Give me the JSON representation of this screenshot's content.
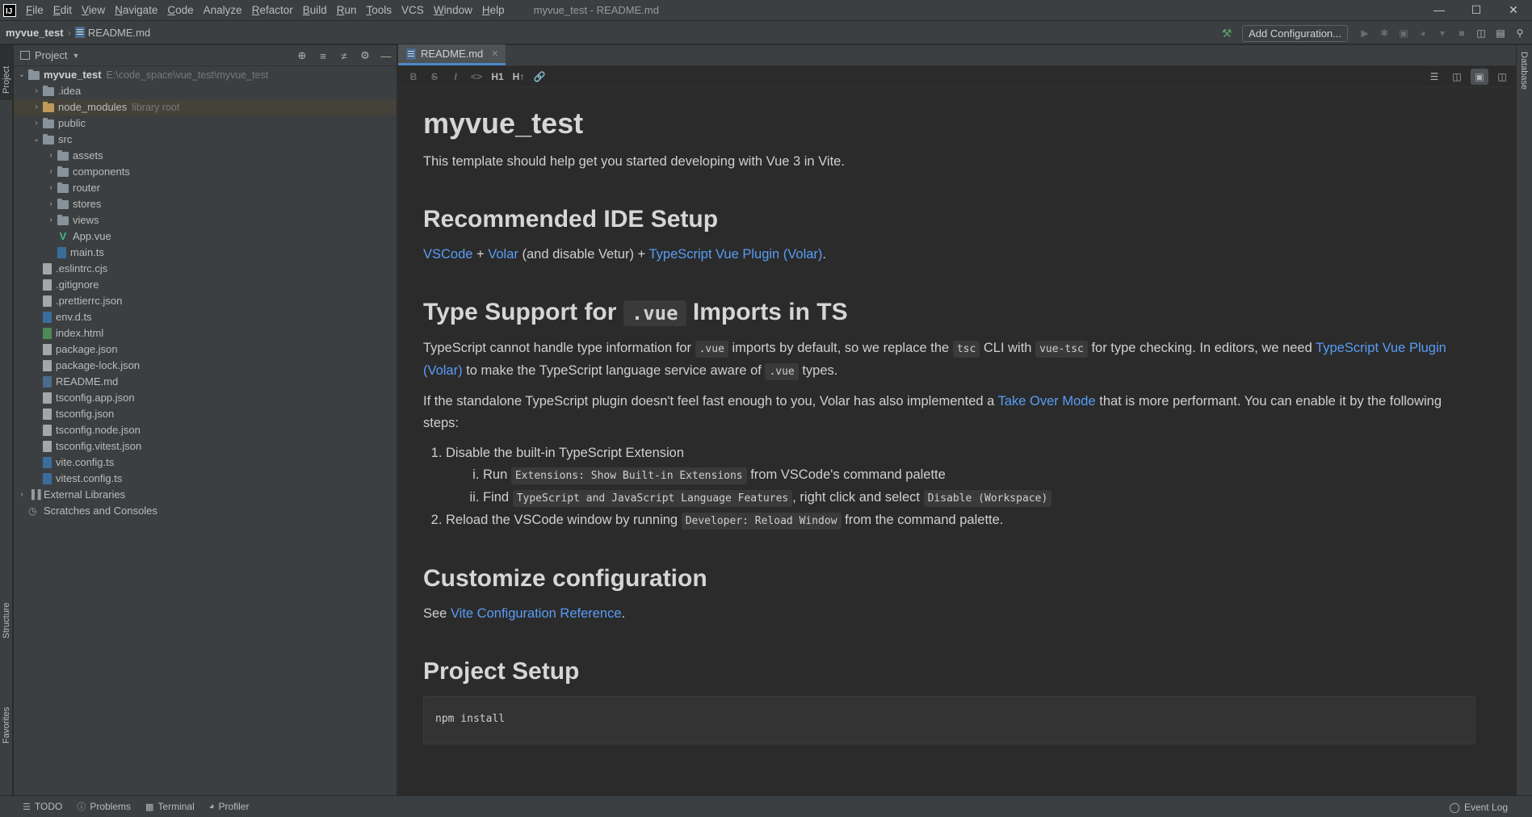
{
  "window": {
    "title": "myvue_test - README.md",
    "logo": "IJ"
  },
  "menu": {
    "items": [
      {
        "u": "F",
        "rest": "ile"
      },
      {
        "u": "E",
        "rest": "dit"
      },
      {
        "u": "V",
        "rest": "iew"
      },
      {
        "u": "N",
        "rest": "avigate"
      },
      {
        "u": "C",
        "rest": "ode"
      },
      {
        "u": "",
        "rest": "Analyze"
      },
      {
        "u": "R",
        "rest": "efactor"
      },
      {
        "u": "B",
        "rest": "uild"
      },
      {
        "u": "R",
        "rest": "un"
      },
      {
        "u": "T",
        "rest": "ools"
      },
      {
        "u": "",
        "rest": "VCS"
      },
      {
        "u": "W",
        "rest": "indow"
      },
      {
        "u": "H",
        "rest": "elp"
      }
    ]
  },
  "breadcrumb": {
    "project": "myvue_test",
    "file": "README.md"
  },
  "toolbar": {
    "add_config_label": "Add Configuration..."
  },
  "left_strip": {
    "project_label": "Project",
    "structure_label": "Structure",
    "favorites_label": "Favorites"
  },
  "right_strip": {
    "database_label": "Database"
  },
  "project_panel": {
    "title": "Project",
    "tree": {
      "root_name": "myvue_test",
      "root_path": "E:\\code_space\\vue_test\\myvue_test",
      "idea": ".idea",
      "node_modules": "node_modules",
      "node_modules_hint": "library root",
      "public": "public",
      "src": "src",
      "assets": "assets",
      "components": "components",
      "router": "router",
      "stores": "stores",
      "views": "views",
      "app_vue": "App.vue",
      "main_ts": "main.ts",
      "eslintrc": ".eslintrc.cjs",
      "gitignore": ".gitignore",
      "prettierrc": ".prettierrc.json",
      "env_d_ts": "env.d.ts",
      "index_html": "index.html",
      "package_json": "package.json",
      "package_lock": "package-lock.json",
      "readme": "README.md",
      "tsconfig_app": "tsconfig.app.json",
      "tsconfig": "tsconfig.json",
      "tsconfig_node": "tsconfig.node.json",
      "tsconfig_vitest": "tsconfig.vitest.json",
      "vite_config": "vite.config.ts",
      "vitest_config": "vitest.config.ts",
      "external_libraries": "External Libraries",
      "scratches": "Scratches and Consoles"
    }
  },
  "editor": {
    "tab_label": "README.md",
    "md_toolbar": {
      "bold": "B",
      "strike": "S",
      "italic": "I",
      "code": "<>",
      "h1": "H1",
      "h_up": "H↑"
    }
  },
  "preview": {
    "h1": "myvue_test",
    "intro": "This template should help get you started developing with Vue 3 in Vite.",
    "h2_ide": "Recommended IDE Setup",
    "ide_vscode": "VSCode",
    "ide_plus1": " + ",
    "ide_volar": "Volar",
    "ide_mid": " (and disable Vetur) + ",
    "ide_plugin": "TypeScript Vue Plugin (Volar)",
    "ide_end": ".",
    "h2_type_pre": "Type Support for ",
    "h2_type_code": ".vue",
    "h2_type_post": " Imports in TS",
    "type_p1_a": "TypeScript cannot handle type information for ",
    "type_p1_code1": ".vue",
    "type_p1_b": " imports by default, so we replace the ",
    "type_p1_code2": "tsc",
    "type_p1_c": " CLI with ",
    "type_p1_code3": "vue-tsc",
    "type_p1_d": " for type checking. In editors, we need ",
    "type_p1_link": "TypeScript Vue Plugin (Volar)",
    "type_p1_e": " to make the TypeScript language service aware of ",
    "type_p1_code4": ".vue",
    "type_p1_f": " types.",
    "type_p2_a": "If the standalone TypeScript plugin doesn't feel fast enough to you, Volar has also implemented a ",
    "type_p2_link": "Take Over Mode",
    "type_p2_b": " that is more performant. You can enable it by the following steps:",
    "step1": "Disable the built-in TypeScript Extension",
    "step1a_pre": "Run ",
    "step1a_code": "Extensions: Show Built-in Extensions",
    "step1a_post": " from VSCode's command palette",
    "step1b_pre": "Find ",
    "step1b_code": "TypeScript and JavaScript Language Features",
    "step1b_mid": ", right click and select ",
    "step1b_code2": "Disable (Workspace)",
    "step2_pre": "Reload the VSCode window by running ",
    "step2_code": "Developer: Reload Window",
    "step2_post": " from the command palette.",
    "h2_custom": "Customize configuration",
    "custom_pre": "See ",
    "custom_link": "Vite Configuration Reference",
    "custom_post": ".",
    "h2_setup": "Project Setup",
    "setup_code": "npm install"
  },
  "statusbar": {
    "todo": "TODO",
    "problems": "Problems",
    "terminal": "Terminal",
    "profiler": "Profiler",
    "event_log": "Event Log"
  },
  "colors": {
    "bg": "#2b2b2b",
    "panel": "#3c3f41",
    "link": "#589df6",
    "highlight_row": "#45423a",
    "vue_green": "#41b883",
    "tab_underline": "#4a88c7"
  }
}
